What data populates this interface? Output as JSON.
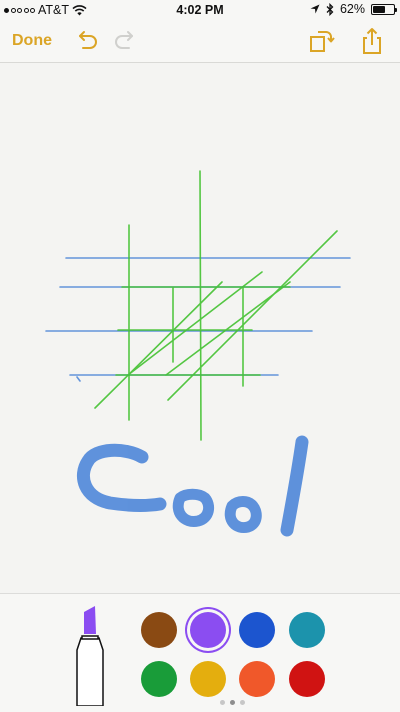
{
  "status_bar": {
    "carrier": "AT&T",
    "time": "4:02 PM",
    "battery": "62%",
    "battery_level": 0.62,
    "signal_strength": 1,
    "signal_total": 5,
    "icons": [
      "wifi-icon",
      "location-arrow-icon",
      "bluetooth-icon",
      "battery-icon"
    ]
  },
  "toolbar": {
    "done_label": "Done",
    "accent_color": "#DBA526",
    "icons": [
      "undo-icon",
      "redo-icon",
      "rotate-icon",
      "share-icon"
    ]
  },
  "canvas": {
    "handwritten_text": "Cool",
    "stroke_colors": {
      "blue": "#4A84D8",
      "green": "#43C231"
    }
  },
  "palette": {
    "tool": "marker-icon",
    "selected_color": "#8B4DF1",
    "colors": [
      "#8A4A13",
      "#8B4DF1",
      "#1C55CF",
      "#1C93AC",
      "#199C39",
      "#E4AE0E",
      "#F0582A",
      "#D01312"
    ],
    "page": 2,
    "pages": 3
  }
}
